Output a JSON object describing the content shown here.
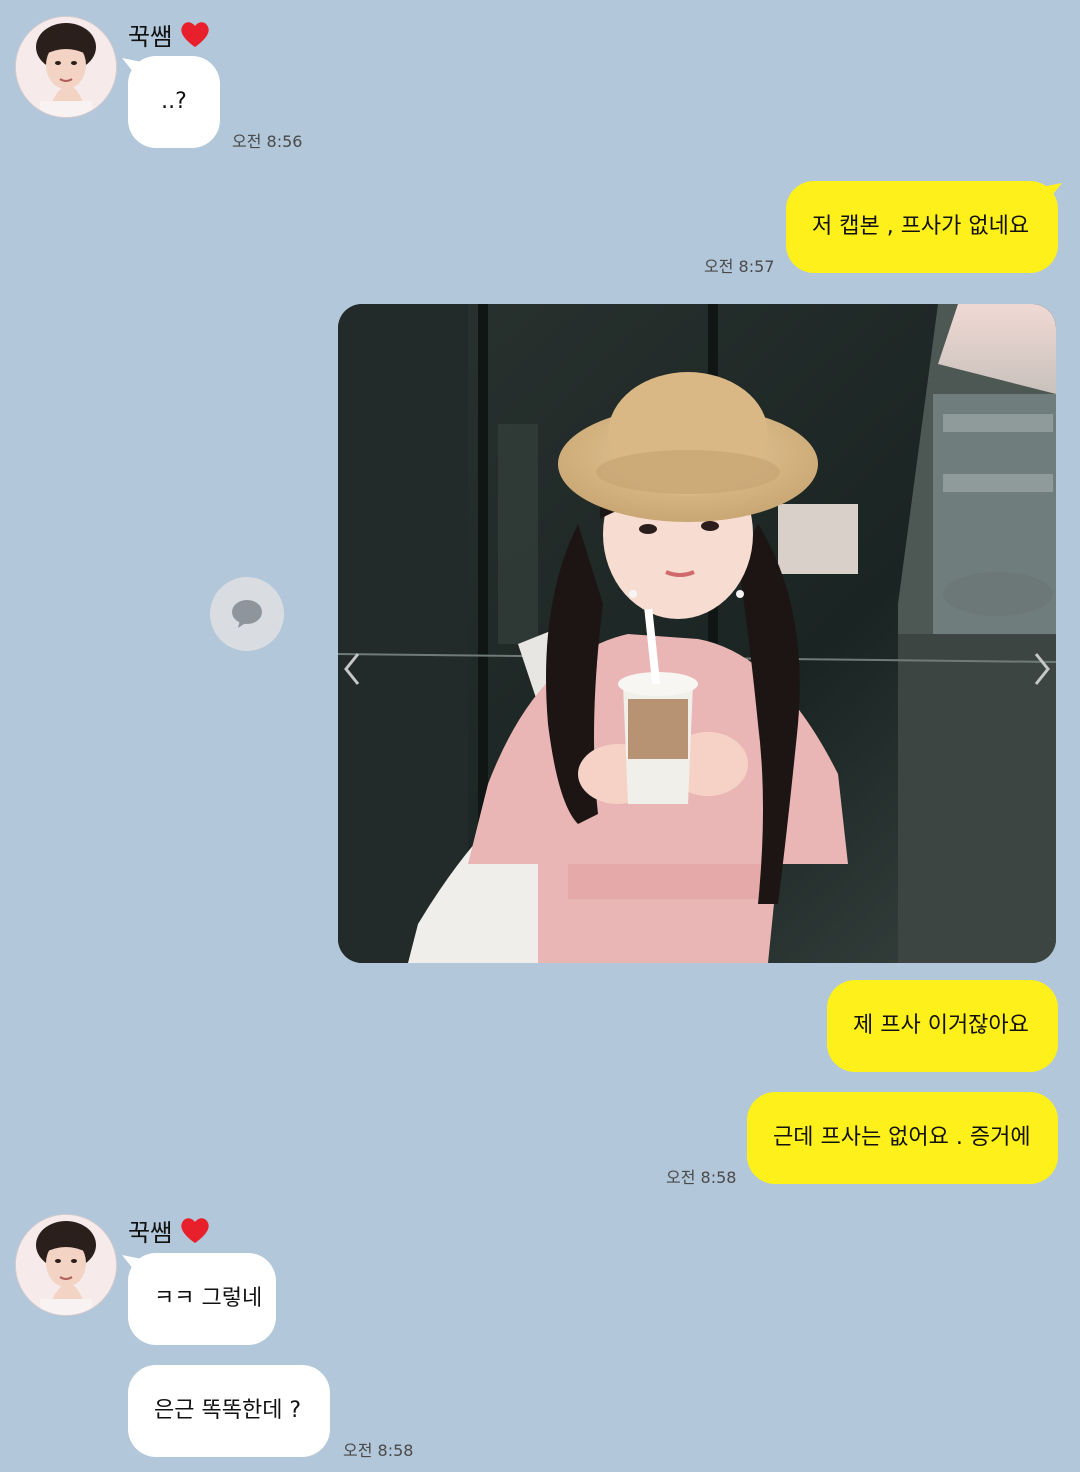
{
  "colors": {
    "background": "#b2c7d9",
    "incoming_bubble": "#ffffff",
    "outgoing_bubble": "#fef01b",
    "heart": "#e8202b"
  },
  "groups": [
    {
      "sender": "꾹쌤",
      "messages": [
        "..?"
      ],
      "time": "오전 8:56"
    },
    {
      "messages": [
        "저 캡본 , 프사가 없네요"
      ],
      "time": "오전 8:57"
    },
    {
      "messages": [
        "제 프사 이거잖아요",
        "근데 프사는 없어요 . 증거에"
      ],
      "time": "오전 8:58"
    },
    {
      "sender": "꾹쌤",
      "messages": [
        "ㅋㅋ 그렇네",
        "은근 똑똑한데 ?"
      ],
      "time": "오전 8:58"
    }
  ],
  "icons": {
    "sender_badge": "heart-icon",
    "share": "speech-bubble-icon",
    "photo_prev": "chevron-left-icon",
    "photo_next": "chevron-right-icon"
  }
}
